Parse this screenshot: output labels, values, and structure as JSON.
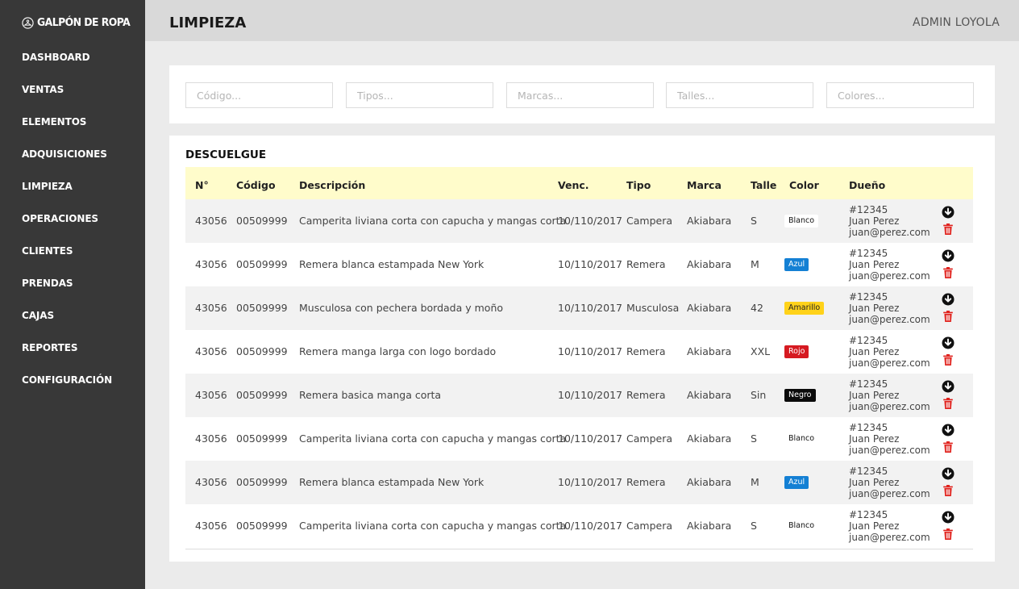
{
  "brand": {
    "name": "GALPÓN DE ROPA",
    "icon": "hanger-circle-icon"
  },
  "nav": [
    {
      "label": "DASHBOARD",
      "name": "dashboard"
    },
    {
      "label": "VENTAS",
      "name": "ventas"
    },
    {
      "label": "ELEMENTOS",
      "name": "elementos"
    },
    {
      "label": "ADQUISICIONES",
      "name": "adquisiciones"
    },
    {
      "label": "LIMPIEZA",
      "name": "limpieza"
    },
    {
      "label": "OPERACIONES",
      "name": "operaciones"
    },
    {
      "label": "CLIENTES",
      "name": "clientes"
    },
    {
      "label": "PRENDAS",
      "name": "prendas"
    },
    {
      "label": "CAJAS",
      "name": "cajas"
    },
    {
      "label": "REPORTES",
      "name": "reportes"
    },
    {
      "label": "CONFIGURACIÓN",
      "name": "configuracion"
    }
  ],
  "header": {
    "title": "LIMPIEZA",
    "user": "ADMIN LOYOLA"
  },
  "filters": [
    {
      "name": "codigo",
      "placeholder": "Código...",
      "value": ""
    },
    {
      "name": "tipos",
      "placeholder": "Tipos...",
      "value": ""
    },
    {
      "name": "marcas",
      "placeholder": "Marcas...",
      "value": ""
    },
    {
      "name": "talles",
      "placeholder": "Talles...",
      "value": ""
    },
    {
      "name": "colores",
      "placeholder": "Colores...",
      "value": ""
    }
  ],
  "table": {
    "title": "DESCUELGUE",
    "columns": [
      "N°",
      "Código",
      "Descripción",
      "Venc.",
      "Tipo",
      "Marca",
      "Talle",
      "Color",
      "Dueño"
    ],
    "rows": [
      {
        "n": "43056",
        "codigo": "00509999",
        "descripcion": "Camperita liviana corta con capucha y mangas corta",
        "venc": "10/110/2017",
        "tipo": "Campera",
        "marca": "Akiabara",
        "talle": "S",
        "color": "Blanco",
        "owner_id": "#12345",
        "owner_name": "Juan Perez",
        "owner_email": "juan@perez.com"
      },
      {
        "n": "43056",
        "codigo": "00509999",
        "descripcion": "Remera blanca estampada New York",
        "venc": "10/110/2017",
        "tipo": "Remera",
        "marca": "Akiabara",
        "talle": "M",
        "color": "Azul",
        "owner_id": "#12345",
        "owner_name": "Juan Perez",
        "owner_email": "juan@perez.com"
      },
      {
        "n": "43056",
        "codigo": "00509999",
        "descripcion": "Musculosa con pechera bordada y moño",
        "venc": "10/110/2017",
        "tipo": "Musculosa",
        "marca": "Akiabara",
        "talle": "42",
        "color": "Amarillo",
        "owner_id": "#12345",
        "owner_name": "Juan Perez",
        "owner_email": "juan@perez.com"
      },
      {
        "n": "43056",
        "codigo": "00509999",
        "descripcion": "Remera manga larga con logo bordado",
        "venc": "10/110/2017",
        "tipo": "Remera",
        "marca": "Akiabara",
        "talle": "XXL",
        "color": "Rojo",
        "owner_id": "#12345",
        "owner_name": "Juan Perez",
        "owner_email": "juan@perez.com"
      },
      {
        "n": "43056",
        "codigo": "00509999",
        "descripcion": "Remera basica manga corta",
        "venc": "10/110/2017",
        "tipo": "Remera",
        "marca": "Akiabara",
        "talle": "Sin",
        "color": "Negro",
        "owner_id": "#12345",
        "owner_name": "Juan Perez",
        "owner_email": "juan@perez.com"
      },
      {
        "n": "43056",
        "codigo": "00509999",
        "descripcion": "Camperita liviana corta con capucha y mangas corta",
        "venc": "10/110/2017",
        "tipo": "Campera",
        "marca": "Akiabara",
        "talle": "S",
        "color": "Blanco",
        "owner_id": "#12345",
        "owner_name": "Juan Perez",
        "owner_email": "juan@perez.com"
      },
      {
        "n": "43056",
        "codigo": "00509999",
        "descripcion": "Remera blanca estampada New York",
        "venc": "10/110/2017",
        "tipo": "Remera",
        "marca": "Akiabara",
        "talle": "M",
        "color": "Azul",
        "owner_id": "#12345",
        "owner_name": "Juan Perez",
        "owner_email": "juan@perez.com"
      },
      {
        "n": "43056",
        "codigo": "00509999",
        "descripcion": "Camperita liviana corta con capucha y mangas corta",
        "venc": "10/110/2017",
        "tipo": "Campera",
        "marca": "Akiabara",
        "talle": "S",
        "color": "Blanco",
        "owner_id": "#12345",
        "owner_name": "Juan Perez",
        "owner_email": "juan@perez.com"
      }
    ],
    "row_actions": {
      "download_icon": "arrow-down-circle-icon",
      "delete_icon": "trash-icon",
      "delete_color": "#e0201b"
    }
  },
  "badge_colors": {
    "Blanco": {
      "bg": "#ffffff",
      "fg": "#111111"
    },
    "Azul": {
      "bg": "#1480d4",
      "fg": "#ffffff"
    },
    "Amarillo": {
      "bg": "#ffd21a",
      "fg": "#222222"
    },
    "Rojo": {
      "bg": "#d61a21",
      "fg": "#ffffff"
    },
    "Negro": {
      "bg": "#0b0b0b",
      "fg": "#ffffff"
    }
  },
  "colors": {
    "sidebar_bg": "#383838",
    "topbar_bg": "#d9d9d9",
    "page_bg": "#ebebeb",
    "table_header_bg": "#fffccb"
  }
}
